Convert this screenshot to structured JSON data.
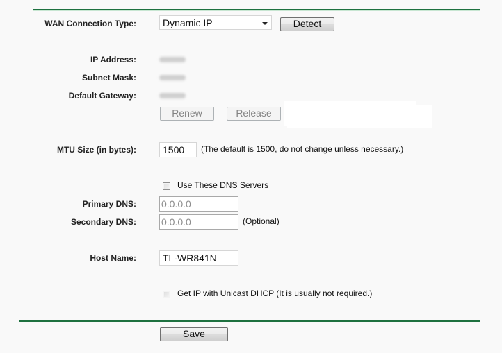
{
  "wan": {
    "label": "WAN Connection Type:",
    "selected": "Dynamic IP",
    "detect_label": "Detect"
  },
  "status": {
    "ip_label": "IP Address:",
    "subnet_label": "Subnet Mask:",
    "gateway_label": "Default Gateway:",
    "renew_label": "Renew",
    "release_label": "Release"
  },
  "mtu": {
    "label": "MTU Size (in bytes):",
    "value": "1500",
    "hint": "(The default is 1500, do not change unless necessary.)"
  },
  "dns": {
    "use_label": "Use These DNS Servers",
    "use_checked": false,
    "primary_label": "Primary DNS:",
    "primary_value": "0.0.0.0",
    "secondary_label": "Secondary DNS:",
    "secondary_value": "0.0.0.0",
    "optional_label": "(Optional)"
  },
  "host": {
    "label": "Host Name:",
    "value": "TL-WR841N"
  },
  "unicast": {
    "label": "Get IP with Unicast DHCP (It is usually not required.)",
    "checked": false
  },
  "footer": {
    "save_label": "Save"
  },
  "colors": {
    "rule": "#1e7140",
    "background": "#f9f9f9"
  }
}
